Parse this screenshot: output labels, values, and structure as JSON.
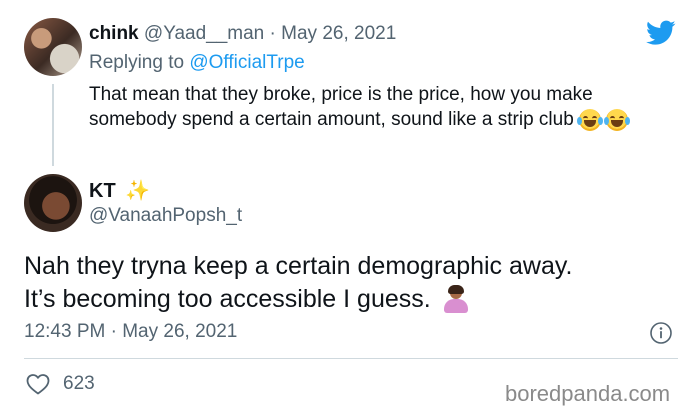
{
  "reply_tweet": {
    "display_name": "chink",
    "handle": "@Yaad__man",
    "separator": "·",
    "date": "May 26, 2021",
    "replying_prefix": "Replying to",
    "replying_to": "@OfficialTrpe",
    "text": "That mean that they broke, price is the price, how you make somebody spend a certain amount, sound like a strip club",
    "emoji": "face-with-tears-of-joy"
  },
  "main_tweet": {
    "display_name": "KT",
    "name_emoji": "✨",
    "handle": "@VanaahPopsh_t",
    "text_line1": "Nah they tryna keep a certain demographic away.",
    "text_line2": "It’s becoming too accessible I guess.",
    "emoji": "person-shrugging",
    "time": "12:43 PM",
    "separator": "·",
    "date": "May 26, 2021",
    "likes": "623"
  },
  "watermark": "boredpanda.com",
  "colors": {
    "text": "#0f1419",
    "muted": "#536471",
    "link": "#1d9bf0",
    "divider": "#cfd9de",
    "twitter_blue": "#1d9bf0"
  }
}
